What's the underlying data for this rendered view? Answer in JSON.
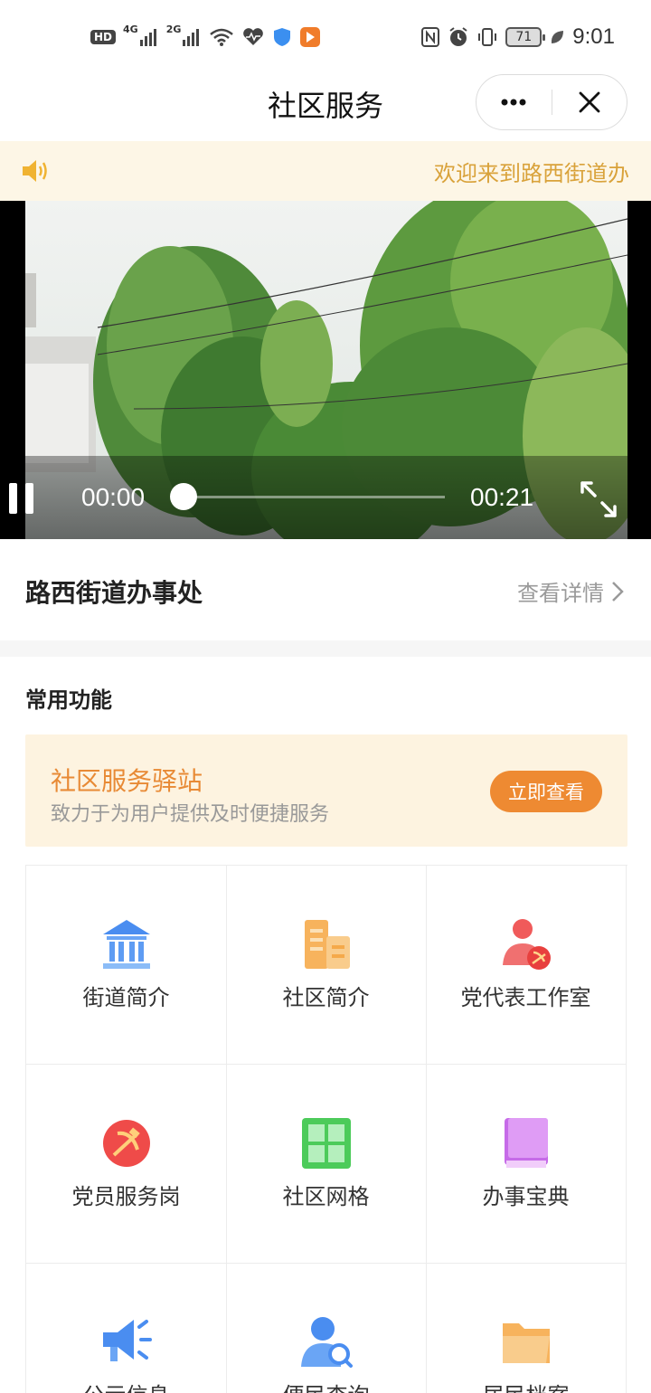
{
  "status_bar": {
    "hd": "HD",
    "sig1": "4G",
    "sig2": "2G",
    "battery": "71",
    "time": "9:01"
  },
  "title_bar": {
    "title": "社区服务",
    "more_icon": "more-dots-icon",
    "close_icon": "close-icon"
  },
  "notice": {
    "text": "欢迎来到路西街道办"
  },
  "video": {
    "current_time": "00:00",
    "total_time": "00:21",
    "progress": 0
  },
  "street": {
    "name": "路西街道办事处",
    "details": "查看详情"
  },
  "common": {
    "title": "常用功能"
  },
  "banner": {
    "title": "社区服务驿站",
    "subtitle": "致力于为用户提供及时便捷服务",
    "button": "立即查看"
  },
  "grid": [
    {
      "label": "街道简介",
      "icon": "government-building-icon"
    },
    {
      "label": "社区简介",
      "icon": "buildings-icon"
    },
    {
      "label": "党代表工作室",
      "icon": "party-representative-icon"
    },
    {
      "label": "党员服务岗",
      "icon": "party-emblem-icon"
    },
    {
      "label": "社区网格",
      "icon": "grid-icon"
    },
    {
      "label": "办事宝典",
      "icon": "book-icon"
    },
    {
      "label": "公示信息",
      "icon": "megaphone-icon"
    },
    {
      "label": "便民查询",
      "icon": "person-search-icon"
    },
    {
      "label": "居民档案",
      "icon": "folder-icon"
    }
  ],
  "colors": {
    "accent": "#ee8a32",
    "notice_bg": "#fdf6e6",
    "notice_text": "#d9a23a"
  }
}
